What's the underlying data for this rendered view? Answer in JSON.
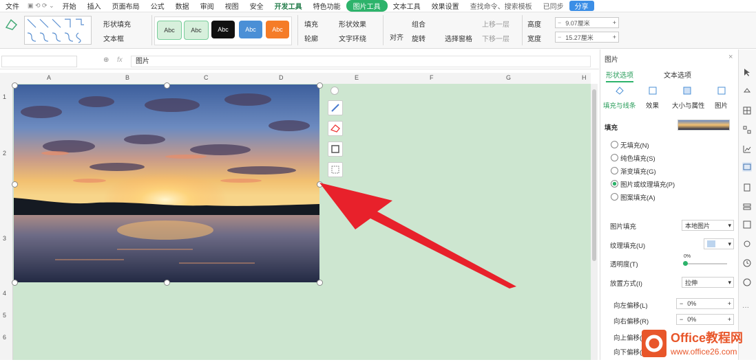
{
  "menubar": {
    "items": [
      "文件",
      "开始",
      "插入",
      "页面布局",
      "公式",
      "数据",
      "审阅",
      "视图",
      "安全",
      "开发工具",
      "特色功能",
      "图片工具",
      "文本工具",
      "效果设置"
    ],
    "active_index": 11,
    "right_items": [
      "查找命令、搜索模板",
      "已同步",
      "分享"
    ]
  },
  "ribbon": {
    "shape_styles": [
      "Abc",
      "Abc",
      "Abc",
      "Abc",
      "Abc"
    ],
    "shape_style_colors": [
      "#d7f0dc",
      "#d7f0dc",
      "#111111",
      "#4a8fd6",
      "#f57c28"
    ],
    "left_labels": {
      "shape_fill": "形状填充",
      "text_box": "文本框"
    },
    "mid_labels": {
      "fill": "填充",
      "outline": "轮廓",
      "effect": "形状效果",
      "text_wrap": "文字环绕"
    },
    "arrange_labels": {
      "align": "对齐",
      "rotate": "旋转",
      "selection_pane": "选择窗格",
      "group": "组合",
      "bring_forward": "上移一层",
      "send_backward": "下移一层"
    },
    "size_labels": {
      "height": "高度",
      "width": "宽度"
    },
    "height_value": "9.07厘米",
    "width_value": "15.27厘米"
  },
  "formula_bar": {
    "name_box": "",
    "content": "图片"
  },
  "sheet": {
    "columns": [
      "A",
      "B",
      "C",
      "D",
      "E",
      "F",
      "G",
      "H"
    ],
    "rows": [
      "1",
      "2",
      "3",
      "4",
      "5",
      "6"
    ]
  },
  "panel": {
    "title": "图片",
    "tabs": [
      "形状选项",
      "文本选项"
    ],
    "icon_tabs": [
      "填充与线条",
      "效果",
      "大小与属性",
      "图片"
    ],
    "section_fill": "填充",
    "fill_options": [
      "无填充(N)",
      "纯色填充(S)",
      "渐变填充(G)",
      "图片或纹理填充(P)",
      "图案填充(A)"
    ],
    "selected_fill_index": 3,
    "image_fill_label": "图片填充",
    "image_fill_value": "本地图片",
    "texture_label": "纹理填充(U)",
    "transparency_label": "透明度(T)",
    "transparency_value": "0%",
    "tile_label": "放置方式(I)",
    "tile_value": "拉伸",
    "offset_left_label": "向左偏移(L)",
    "offset_left_value": "0%",
    "offset_right_label": "向右偏移(R)",
    "offset_right_value": "0%",
    "offset_top_label": "向上偏移(O)",
    "offset_bottom_label": "向下偏移(M)"
  },
  "logo": {
    "title": "Office教程网",
    "url": "www.office26.com"
  },
  "colors": {
    "accent": "#2db36b",
    "sheet_bg": "#cde6d0",
    "arrow": "#e8212b",
    "logo": "#e8562a"
  }
}
